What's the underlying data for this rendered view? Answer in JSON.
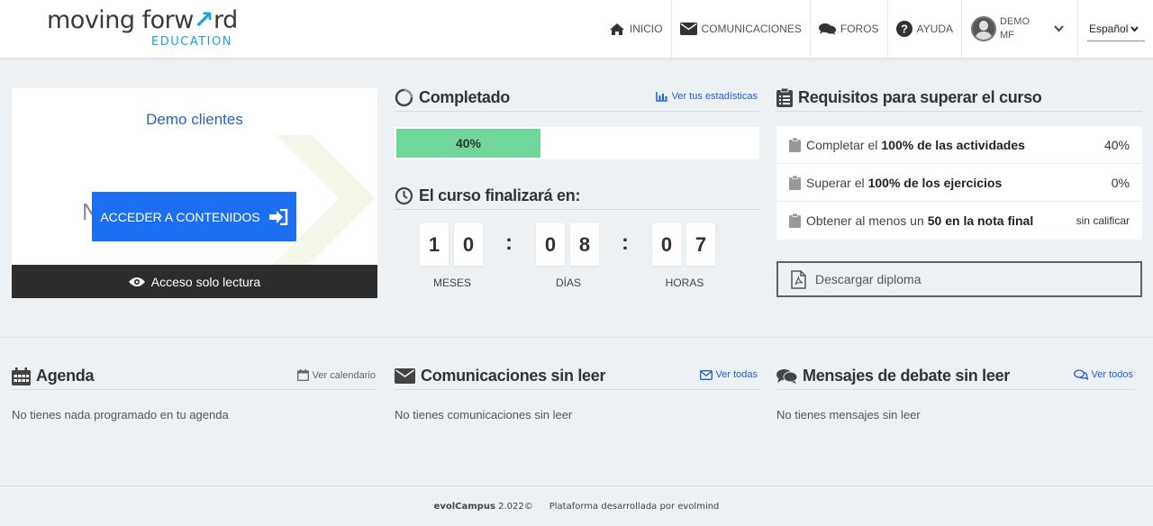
{
  "header": {
    "logo_main_prefix": "moving forw",
    "logo_main_arrow": "ↇ",
    "logo_main_suffix": "rd",
    "logo_sub": "EDUCATION",
    "nav": [
      {
        "label": "INICIO",
        "icon": "home-icon"
      },
      {
        "label": "COMUNICACIONES",
        "icon": "envelope-icon"
      },
      {
        "label": "FOROS",
        "icon": "comments-icon"
      },
      {
        "label": "AYUDA",
        "icon": "question-circle-icon"
      }
    ],
    "user_name": "DEMO MF",
    "language": "Español"
  },
  "course": {
    "title": "Demo clientes",
    "bg_text": "NO",
    "bg_text_2": "D",
    "access_button": "ACCEDER A CONTENIDOS",
    "readonly_label": "Acceso solo lectura"
  },
  "completed": {
    "title": "Completado",
    "stats_link": "Ver tus estadísticas",
    "progress_label": "40%",
    "progress_value": 0.4
  },
  "countdown": {
    "title": "El curso finalizará en:",
    "months": [
      "1",
      "0"
    ],
    "days": [
      "0",
      "8"
    ],
    "hours": [
      "0",
      "7"
    ],
    "months_label": "MESES",
    "days_label": "DÍAS",
    "hours_label": "HORAS",
    "separator": ":"
  },
  "requirements": {
    "title": "Requisitos para superar el curso",
    "items": [
      {
        "prefix": "Completar el",
        "bold": "100% de las actividades",
        "suffix": "",
        "value": "40%"
      },
      {
        "prefix": "Superar el",
        "bold": "100% de los ejercicios",
        "suffix": "",
        "value": "0%"
      },
      {
        "prefix": "Obtener al menos un",
        "bold": "50 en la nota final",
        "suffix": "",
        "value": "sin calificar"
      }
    ],
    "diploma_button": "Descargar diploma"
  },
  "agenda": {
    "title": "Agenda",
    "link": "Ver calendario",
    "empty": "No tienes nada programado en tu agenda"
  },
  "communications": {
    "title": "Comunicaciones sin leer",
    "link": "Ver todas",
    "empty": "No tienes comunicaciones sin leer"
  },
  "messages": {
    "title": "Mensajes de debate sin leer",
    "link": "Ver todos",
    "empty": "No tienes mensajes sin leer"
  },
  "footer": {
    "brand": "evolCampus",
    "version": "2.022©",
    "credit": "Plataforma desarrollada por evolmind"
  },
  "colors": {
    "accent_blue": "#1c6ff0",
    "link_blue": "#1d5fd0",
    "progress_green": "#71d69b",
    "logo_blue": "#1ea0d6"
  }
}
